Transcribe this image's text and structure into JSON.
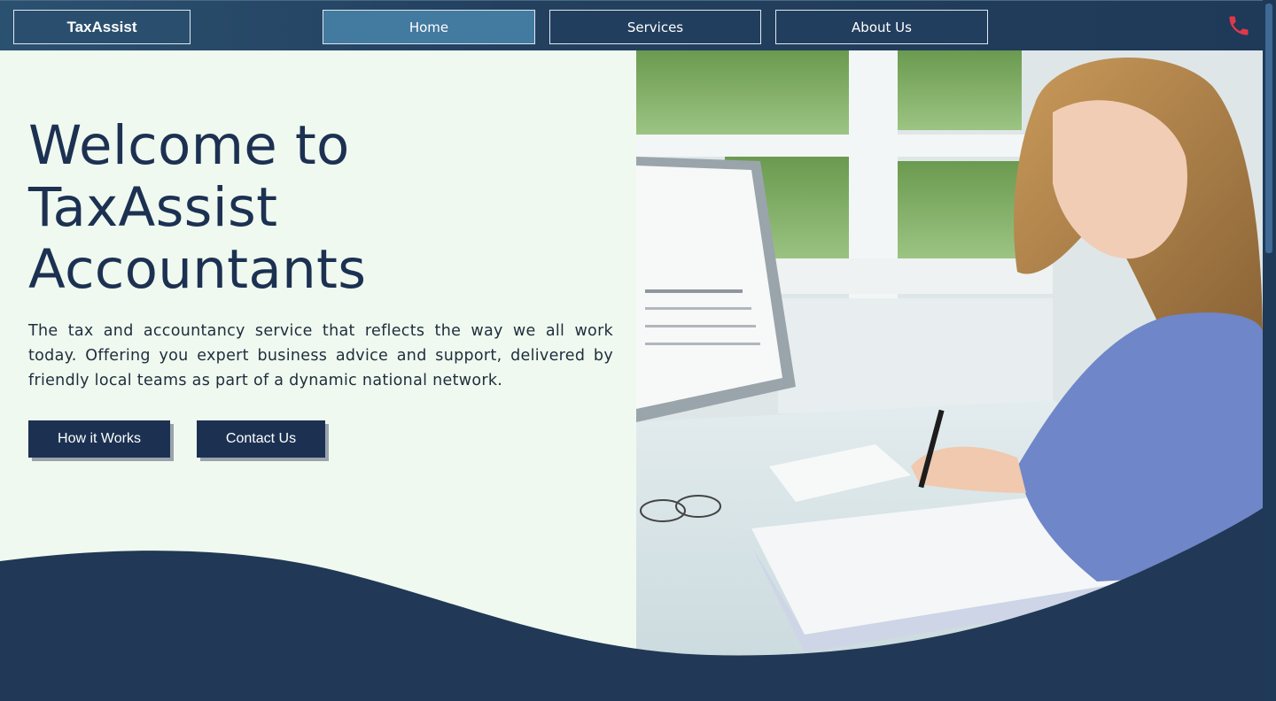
{
  "nav": {
    "brand": "TaxAssist",
    "items": [
      {
        "label": "Home",
        "active": true
      },
      {
        "label": "Services",
        "active": false
      },
      {
        "label": "About Us",
        "active": false
      }
    ],
    "phone_icon": "phone-icon",
    "phone_color": "#e2374a"
  },
  "hero": {
    "title_line1": "Welcome to",
    "title_line2": "TaxAssist",
    "title_line3": "Accountants",
    "description": "The tax and accountancy service that reflects the way we all work today. Offering you expert business advice and support, delivered by friendly local teams as part of a dynamic national network.",
    "buttons": {
      "how": "How it Works",
      "contact": "Contact Us"
    }
  },
  "colors": {
    "navy": "#1c3152",
    "nav_active": "#437a9f",
    "hero_bg": "#eff9ef"
  }
}
